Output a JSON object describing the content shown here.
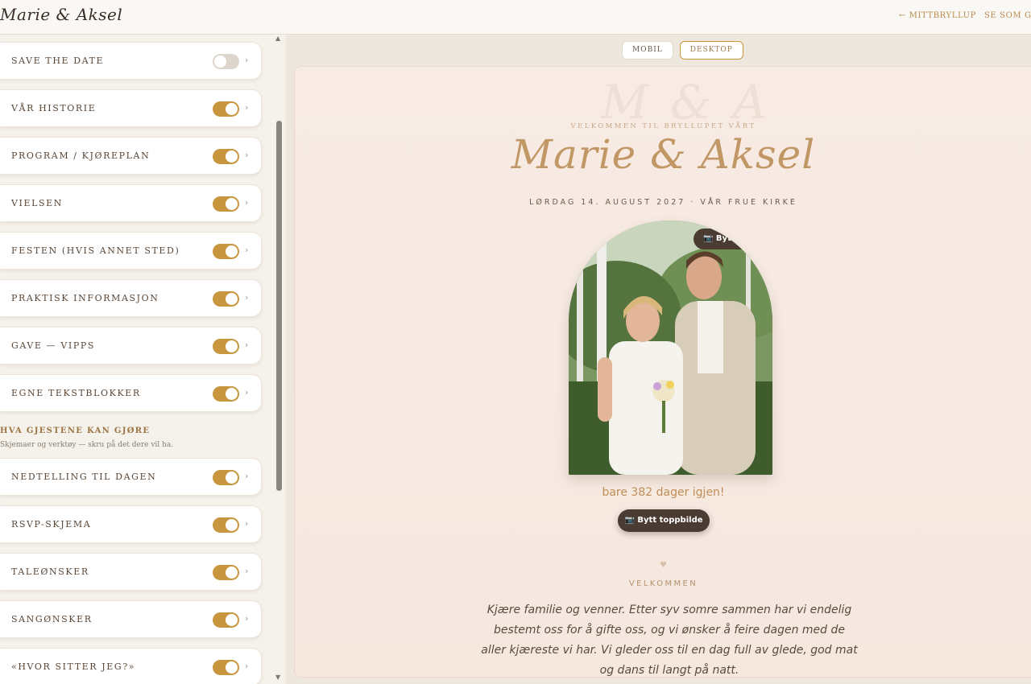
{
  "app": {
    "brand": "Marie & Aksel",
    "nav": {
      "back_label": "← MITTBRYLLUP",
      "guest_view_label": "SE SOM GJ"
    }
  },
  "sidebar": {
    "sections_top": [
      {
        "label": "Save the date",
        "enabled": false
      },
      {
        "label": "Vår historie",
        "enabled": true
      },
      {
        "label": "Program / kjøreplan",
        "enabled": true
      },
      {
        "label": "Vielsen",
        "enabled": true
      },
      {
        "label": "Festen (hvis annet sted)",
        "enabled": true
      },
      {
        "label": "Praktisk informasjon",
        "enabled": true
      },
      {
        "label": "Gave — Vipps",
        "enabled": true
      },
      {
        "label": "Egne tekstblokker",
        "enabled": true
      }
    ],
    "guest_section": {
      "title": "Hva gjestene kan gjøre",
      "subtitle": "Skjemaer og verktøy — skru på det dere vil ha."
    },
    "sections_guest": [
      {
        "label": "Nedtelling til dagen",
        "enabled": true
      },
      {
        "label": "RSVP-skjema",
        "enabled": true
      },
      {
        "label": "Taleønsker",
        "enabled": true
      },
      {
        "label": "Sangønsker",
        "enabled": true
      },
      {
        "label": "«Hvor sitter jeg?»",
        "enabled": true
      }
    ],
    "chevron": "›"
  },
  "preview": {
    "tabs": [
      "MOBIL",
      "DESKTOP"
    ],
    "active_tab": "DESKTOP",
    "monogram": "M & A",
    "welcome_small": "Velkommen til bryllupet vårt",
    "names": "Marie & Aksel",
    "date_line": "Lørdag 14. august 2027 · Vår Frue kirke",
    "photo_badge": "📷 Bytt bilde",
    "countdown": "bare 382 dager igjen!",
    "change_cover_button": "📷 Bytt toppbilde",
    "heart": "♥",
    "section_heading": "Velkommen",
    "welcome_text": "Kjære familie og venner. Etter syv somre sammen har vi endelig bestemt oss for å gifte oss, og vi ønsker å feire dagen med de aller kjæreste vi har. Vi gleder oss til en dag full av glede, god mat og dans til langt på natt."
  },
  "colors": {
    "accent": "#c8963e",
    "toggle_off": "#ddd6cc",
    "dark_button": "#4a3c33",
    "gold_text": "#c19765"
  }
}
